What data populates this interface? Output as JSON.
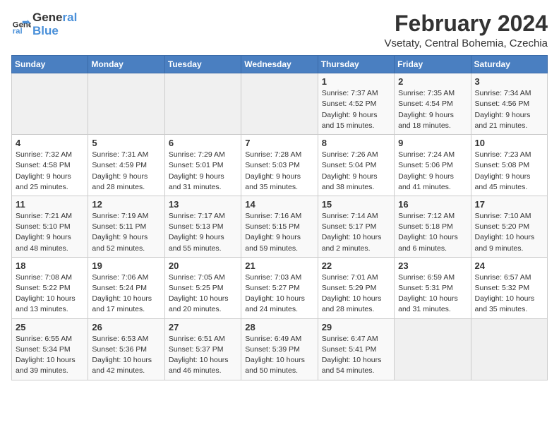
{
  "logo": {
    "line1": "General",
    "line2": "Blue"
  },
  "header": {
    "month_year": "February 2024",
    "location": "Vsetaty, Central Bohemia, Czechia"
  },
  "weekdays": [
    "Sunday",
    "Monday",
    "Tuesday",
    "Wednesday",
    "Thursday",
    "Friday",
    "Saturday"
  ],
  "weeks": [
    [
      {
        "day": "",
        "info": ""
      },
      {
        "day": "",
        "info": ""
      },
      {
        "day": "",
        "info": ""
      },
      {
        "day": "",
        "info": ""
      },
      {
        "day": "1",
        "info": "Sunrise: 7:37 AM\nSunset: 4:52 PM\nDaylight: 9 hours\nand 15 minutes."
      },
      {
        "day": "2",
        "info": "Sunrise: 7:35 AM\nSunset: 4:54 PM\nDaylight: 9 hours\nand 18 minutes."
      },
      {
        "day": "3",
        "info": "Sunrise: 7:34 AM\nSunset: 4:56 PM\nDaylight: 9 hours\nand 21 minutes."
      }
    ],
    [
      {
        "day": "4",
        "info": "Sunrise: 7:32 AM\nSunset: 4:58 PM\nDaylight: 9 hours\nand 25 minutes."
      },
      {
        "day": "5",
        "info": "Sunrise: 7:31 AM\nSunset: 4:59 PM\nDaylight: 9 hours\nand 28 minutes."
      },
      {
        "day": "6",
        "info": "Sunrise: 7:29 AM\nSunset: 5:01 PM\nDaylight: 9 hours\nand 31 minutes."
      },
      {
        "day": "7",
        "info": "Sunrise: 7:28 AM\nSunset: 5:03 PM\nDaylight: 9 hours\nand 35 minutes."
      },
      {
        "day": "8",
        "info": "Sunrise: 7:26 AM\nSunset: 5:04 PM\nDaylight: 9 hours\nand 38 minutes."
      },
      {
        "day": "9",
        "info": "Sunrise: 7:24 AM\nSunset: 5:06 PM\nDaylight: 9 hours\nand 41 minutes."
      },
      {
        "day": "10",
        "info": "Sunrise: 7:23 AM\nSunset: 5:08 PM\nDaylight: 9 hours\nand 45 minutes."
      }
    ],
    [
      {
        "day": "11",
        "info": "Sunrise: 7:21 AM\nSunset: 5:10 PM\nDaylight: 9 hours\nand 48 minutes."
      },
      {
        "day": "12",
        "info": "Sunrise: 7:19 AM\nSunset: 5:11 PM\nDaylight: 9 hours\nand 52 minutes."
      },
      {
        "day": "13",
        "info": "Sunrise: 7:17 AM\nSunset: 5:13 PM\nDaylight: 9 hours\nand 55 minutes."
      },
      {
        "day": "14",
        "info": "Sunrise: 7:16 AM\nSunset: 5:15 PM\nDaylight: 9 hours\nand 59 minutes."
      },
      {
        "day": "15",
        "info": "Sunrise: 7:14 AM\nSunset: 5:17 PM\nDaylight: 10 hours\nand 2 minutes."
      },
      {
        "day": "16",
        "info": "Sunrise: 7:12 AM\nSunset: 5:18 PM\nDaylight: 10 hours\nand 6 minutes."
      },
      {
        "day": "17",
        "info": "Sunrise: 7:10 AM\nSunset: 5:20 PM\nDaylight: 10 hours\nand 9 minutes."
      }
    ],
    [
      {
        "day": "18",
        "info": "Sunrise: 7:08 AM\nSunset: 5:22 PM\nDaylight: 10 hours\nand 13 minutes."
      },
      {
        "day": "19",
        "info": "Sunrise: 7:06 AM\nSunset: 5:24 PM\nDaylight: 10 hours\nand 17 minutes."
      },
      {
        "day": "20",
        "info": "Sunrise: 7:05 AM\nSunset: 5:25 PM\nDaylight: 10 hours\nand 20 minutes."
      },
      {
        "day": "21",
        "info": "Sunrise: 7:03 AM\nSunset: 5:27 PM\nDaylight: 10 hours\nand 24 minutes."
      },
      {
        "day": "22",
        "info": "Sunrise: 7:01 AM\nSunset: 5:29 PM\nDaylight: 10 hours\nand 28 minutes."
      },
      {
        "day": "23",
        "info": "Sunrise: 6:59 AM\nSunset: 5:31 PM\nDaylight: 10 hours\nand 31 minutes."
      },
      {
        "day": "24",
        "info": "Sunrise: 6:57 AM\nSunset: 5:32 PM\nDaylight: 10 hours\nand 35 minutes."
      }
    ],
    [
      {
        "day": "25",
        "info": "Sunrise: 6:55 AM\nSunset: 5:34 PM\nDaylight: 10 hours\nand 39 minutes."
      },
      {
        "day": "26",
        "info": "Sunrise: 6:53 AM\nSunset: 5:36 PM\nDaylight: 10 hours\nand 42 minutes."
      },
      {
        "day": "27",
        "info": "Sunrise: 6:51 AM\nSunset: 5:37 PM\nDaylight: 10 hours\nand 46 minutes."
      },
      {
        "day": "28",
        "info": "Sunrise: 6:49 AM\nSunset: 5:39 PM\nDaylight: 10 hours\nand 50 minutes."
      },
      {
        "day": "29",
        "info": "Sunrise: 6:47 AM\nSunset: 5:41 PM\nDaylight: 10 hours\nand 54 minutes."
      },
      {
        "day": "",
        "info": ""
      },
      {
        "day": "",
        "info": ""
      }
    ]
  ]
}
